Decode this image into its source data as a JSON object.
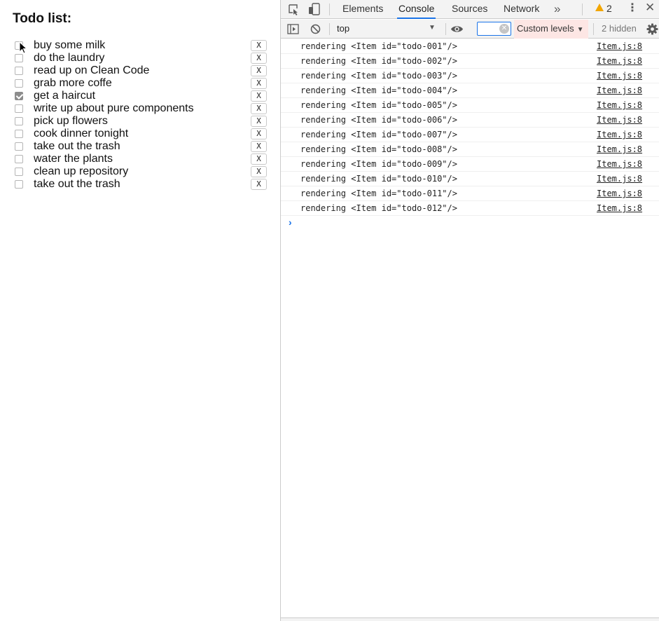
{
  "app": {
    "title": "Todo list:",
    "delete_label": "X",
    "items": [
      {
        "text": "buy some milk",
        "checked": false
      },
      {
        "text": "do the laundry",
        "checked": false
      },
      {
        "text": "read up on Clean Code",
        "checked": false
      },
      {
        "text": "grab more coffe",
        "checked": false
      },
      {
        "text": "get a haircut",
        "checked": true
      },
      {
        "text": "write up about pure components",
        "checked": false
      },
      {
        "text": "pick up flowers",
        "checked": false
      },
      {
        "text": "cook dinner tonight",
        "checked": false
      },
      {
        "text": "take out the trash",
        "checked": false
      },
      {
        "text": "water the plants",
        "checked": false
      },
      {
        "text": "clean up repository",
        "checked": false
      },
      {
        "text": "take out the trash",
        "checked": false
      }
    ]
  },
  "devtools": {
    "tabs": [
      "Elements",
      "Console",
      "Sources",
      "Network"
    ],
    "active_tab": "Console",
    "more_tabs": "»",
    "warning_count": "2",
    "context": "top",
    "filter_value": "",
    "levels_label": "Custom levels",
    "hidden_label": "2 hidden",
    "logs": [
      {
        "message": "rendering <Item id=\"todo-001\"/>",
        "source": "Item.js:8"
      },
      {
        "message": "rendering <Item id=\"todo-002\"/>",
        "source": "Item.js:8"
      },
      {
        "message": "rendering <Item id=\"todo-003\"/>",
        "source": "Item.js:8"
      },
      {
        "message": "rendering <Item id=\"todo-004\"/>",
        "source": "Item.js:8"
      },
      {
        "message": "rendering <Item id=\"todo-005\"/>",
        "source": "Item.js:8"
      },
      {
        "message": "rendering <Item id=\"todo-006\"/>",
        "source": "Item.js:8"
      },
      {
        "message": "rendering <Item id=\"todo-007\"/>",
        "source": "Item.js:8"
      },
      {
        "message": "rendering <Item id=\"todo-008\"/>",
        "source": "Item.js:8"
      },
      {
        "message": "rendering <Item id=\"todo-009\"/>",
        "source": "Item.js:8"
      },
      {
        "message": "rendering <Item id=\"todo-010\"/>",
        "source": "Item.js:8"
      },
      {
        "message": "rendering <Item id=\"todo-011\"/>",
        "source": "Item.js:8"
      },
      {
        "message": "rendering <Item id=\"todo-012\"/>",
        "source": "Item.js:8"
      }
    ]
  },
  "colors": {
    "accent": "#1a73e8",
    "warning": "#f2a600",
    "levels_bg": "#fde6e4",
    "toolbar_bg": "#f3f3f3"
  }
}
